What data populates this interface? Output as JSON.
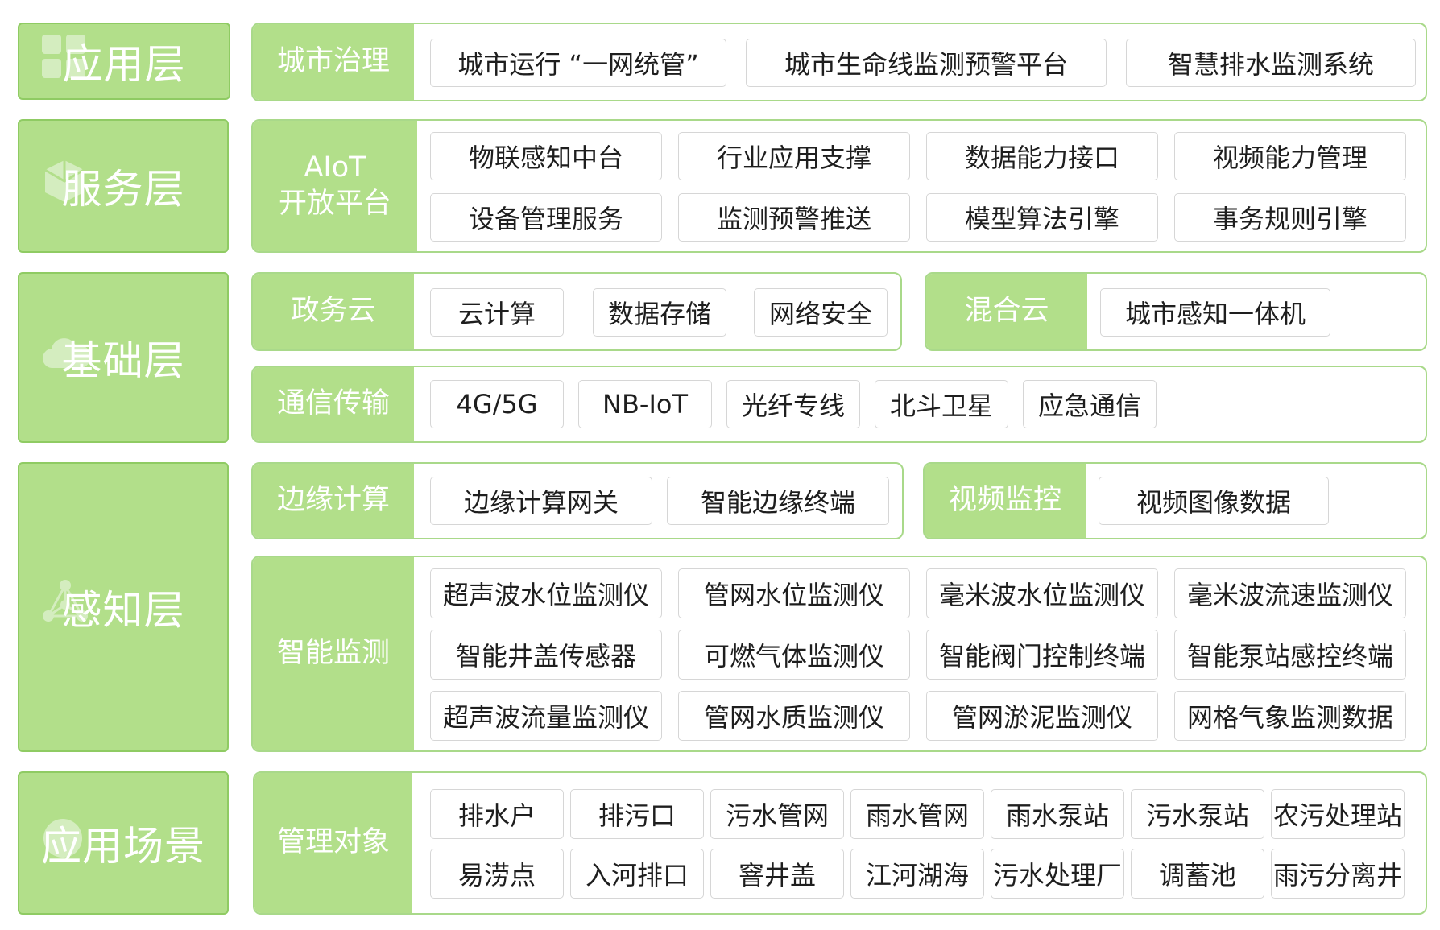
{
  "layers": {
    "application": "应用层",
    "service": "服务层",
    "foundation": "基础层",
    "perception": "感知层",
    "scenario": "应用场景"
  },
  "application_layer": {
    "category": "城市治理",
    "items": [
      "城市运行 “一网统管”",
      "城市生命线监测预警平台",
      "智慧排水监测系统"
    ]
  },
  "service_layer": {
    "category_line1": "AIoT",
    "category_line2": "开放平台",
    "items": [
      "物联感知中台",
      "行业应用支撑",
      "数据能力接口",
      "视频能力管理",
      "设备管理服务",
      "监测预警推送",
      "模型算法引擎",
      "事务规则引擎"
    ]
  },
  "foundation_layer": {
    "gov_cloud": {
      "category": "政务云",
      "items": [
        "云计算",
        "数据存储",
        "网络安全"
      ]
    },
    "hybrid_cloud": {
      "category": "混合云",
      "items": [
        "城市感知一体机"
      ]
    },
    "communication": {
      "category": "通信传输",
      "items": [
        "4G/5G",
        "NB-IoT",
        "光纤专线",
        "北斗卫星",
        "应急通信"
      ]
    }
  },
  "perception_layer": {
    "edge": {
      "category": "边缘计算",
      "items": [
        "边缘计算网关",
        "智能边缘终端"
      ]
    },
    "video": {
      "category": "视频监控",
      "items": [
        "视频图像数据"
      ]
    },
    "monitoring": {
      "category": "智能监测",
      "items": [
        "超声波水位监测仪",
        "管网水位监测仪",
        "毫米波水位监测仪",
        "毫米波流速监测仪",
        "智能井盖传感器",
        "可燃气体监测仪",
        "智能阀门控制终端",
        "智能泵站感控终端",
        "超声波流量监测仪",
        "管网水质监测仪",
        "管网淤泥监测仪",
        "网格气象监测数据"
      ]
    }
  },
  "scenario_layer": {
    "category": "管理对象",
    "items": [
      "排水户",
      "排污口",
      "污水管网",
      "雨水管网",
      "雨水泵站",
      "污水泵站",
      "农污处理站",
      "易涝点",
      "入河排口",
      "窨井盖",
      "江河湖海",
      "污水处理厂",
      "调蓄池",
      "雨污分离井"
    ]
  },
  "colors": {
    "accent": "#b2df8a",
    "border": "#a9d98a",
    "item_border": "#d6d6d6"
  },
  "icons": [
    "grid-icon",
    "cube-icon",
    "cloud-icon",
    "network-icon",
    "pin-icon"
  ]
}
